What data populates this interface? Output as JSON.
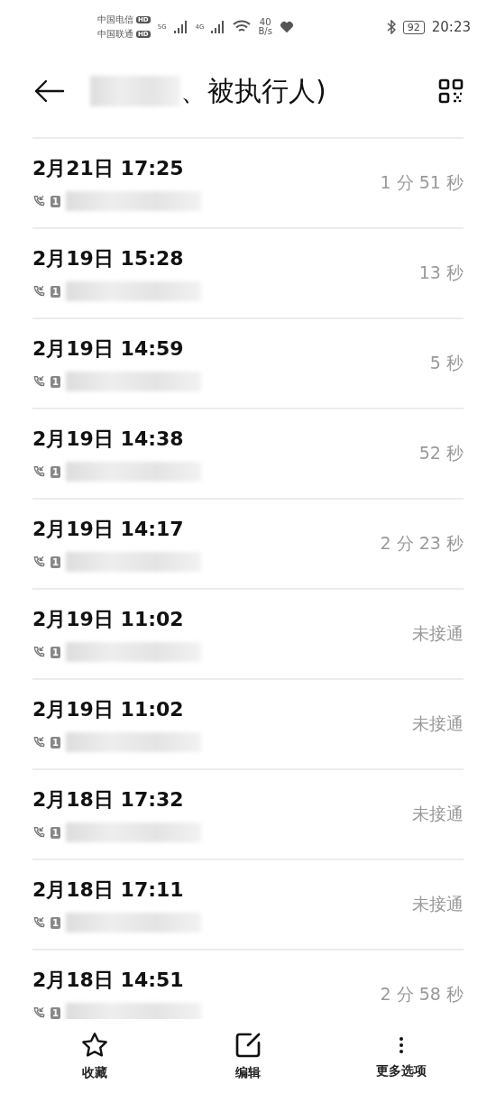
{
  "status_bar": {
    "carriers": [
      {
        "name": "中国电信",
        "badge": "HD"
      },
      {
        "name": "中国联通",
        "badge": "HD"
      }
    ],
    "networks": [
      "5G",
      "4G"
    ],
    "speed_value": "40",
    "speed_unit": "B/s",
    "battery": "92",
    "time": "20:23"
  },
  "header": {
    "title": "、被执行人)"
  },
  "calls": [
    {
      "time": "2月21日 17:25",
      "duration": "1 分 51 秒",
      "sim": "1"
    },
    {
      "time": "2月19日 15:28",
      "duration": "13 秒",
      "sim": "1"
    },
    {
      "time": "2月19日 14:59",
      "duration": "5 秒",
      "sim": "1"
    },
    {
      "time": "2月19日 14:38",
      "duration": "52 秒",
      "sim": "1"
    },
    {
      "time": "2月19日 14:17",
      "duration": "2 分 23 秒",
      "sim": "1"
    },
    {
      "time": "2月19日 11:02",
      "duration": "未接通",
      "sim": "1"
    },
    {
      "time": "2月19日 11:02",
      "duration": "未接通",
      "sim": "1"
    },
    {
      "time": "2月18日 17:32",
      "duration": "未接通",
      "sim": "1"
    },
    {
      "time": "2月18日 17:11",
      "duration": "未接通",
      "sim": "1"
    },
    {
      "time": "2月18日 14:51",
      "duration": "2 分 58 秒",
      "sim": "1"
    }
  ],
  "bottom_bar": [
    {
      "kind": "star",
      "label": "收藏"
    },
    {
      "kind": "edit",
      "label": "编辑"
    },
    {
      "kind": "more",
      "label": "更多选项"
    }
  ]
}
